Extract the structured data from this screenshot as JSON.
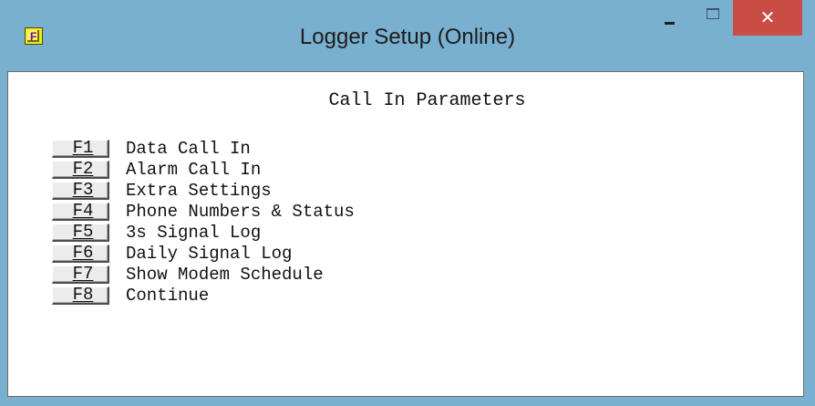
{
  "window": {
    "title": "Logger Setup (Online)",
    "app_icon_letter": "F",
    "close_glyph": "✕"
  },
  "content": {
    "heading": "Call In Parameters",
    "menu": [
      {
        "key": "F1",
        "label": "Data Call In"
      },
      {
        "key": "F2",
        "label": "Alarm Call In"
      },
      {
        "key": "F3",
        "label": "Extra Settings"
      },
      {
        "key": "F4",
        "label": "Phone Numbers & Status"
      },
      {
        "key": "F5",
        "label": "3s Signal Log"
      },
      {
        "key": "F6",
        "label": "Daily Signal Log"
      },
      {
        "key": "F7",
        "label": "Show Modem Schedule"
      },
      {
        "key": "F8",
        "label": "Continue"
      }
    ]
  },
  "colors": {
    "frame": "#7ab0cf",
    "close_button": "#c94c45",
    "client_background": "#ffffff"
  }
}
